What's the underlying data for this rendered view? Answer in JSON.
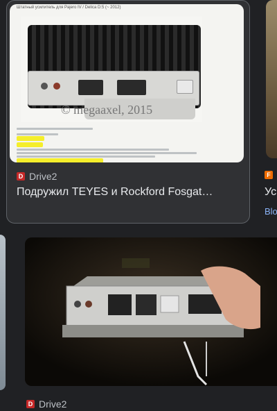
{
  "results": [
    {
      "source": "Drive2",
      "favicon_letter": "D",
      "favicon_color": "#c62828",
      "title": "Подружил TEYES и Rockford Fosgat…",
      "image_header_text": "Штатный усилитель для Pajero IV / Delica D:5 (~ 2012)",
      "image_watermark": "© megaaxel, 2015"
    },
    {
      "favicon_letter": "F",
      "favicon_color": "#ef6c00",
      "title_fragment": "Ус",
      "source_fragment": "Blo"
    },
    {
      "source": "Drive2",
      "favicon_letter": "D",
      "favicon_color": "#c62828"
    }
  ]
}
